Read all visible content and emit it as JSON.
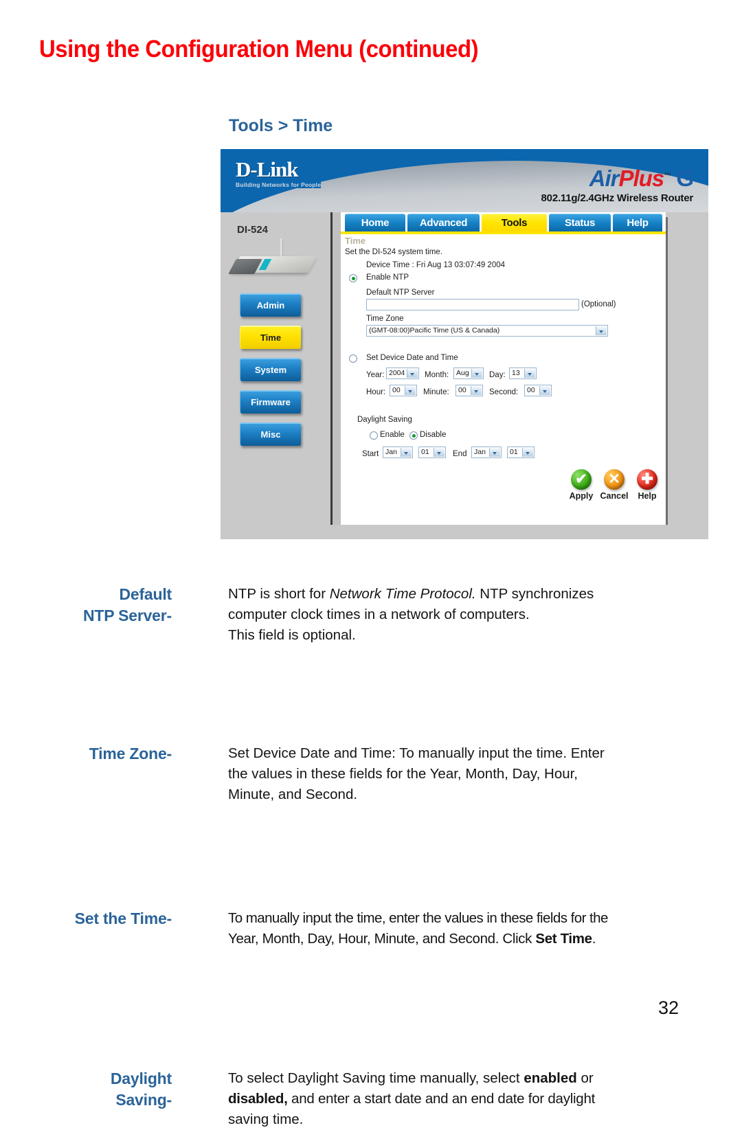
{
  "page": {
    "title": "Using the Configuration Menu (continued)",
    "section_heading": "Tools > Time",
    "page_number": "32",
    "title_color": "#fb0008",
    "heading_color": "#2b6399"
  },
  "screenshot": {
    "brand": {
      "logo": "D-Link",
      "tagline": "Building Networks for People",
      "product_air": "Air",
      "product_plus": "Plus",
      "product_tm": "™",
      "product_g": "G",
      "subtitle": "802.11g/2.4GHz Wireless Router"
    },
    "tabs": [
      {
        "label": "Home",
        "active": false
      },
      {
        "label": "Advanced",
        "active": false
      },
      {
        "label": "Tools",
        "active": true
      },
      {
        "label": "Status",
        "active": false
      },
      {
        "label": "Help",
        "active": false
      }
    ],
    "device": {
      "model": "DI-524",
      "buttons": [
        {
          "label": "Admin",
          "active": false
        },
        {
          "label": "Time",
          "active": true
        },
        {
          "label": "System",
          "active": false
        },
        {
          "label": "Firmware",
          "active": false
        },
        {
          "label": "Misc",
          "active": false
        }
      ]
    },
    "form": {
      "title": "Time",
      "description": "Set the DI-524 system time.",
      "device_time": "Device Time : Fri Aug 13 03:07:49 2004",
      "enable_ntp_label": "Enable NTP",
      "enable_ntp_selected": true,
      "ntp_server_label": "Default NTP Server",
      "ntp_server_value": "",
      "ntp_server_optional": "(Optional)",
      "time_zone_label": "Time Zone",
      "time_zone_value": "(GMT-08:00)Pacific Time (US & Canada)",
      "set_device_label": "Set Device Date and Time",
      "set_device_selected": false,
      "year_label": "Year:",
      "year_value": "2004",
      "month_label": "Month:",
      "month_value": "Aug",
      "day_label": "Day:",
      "day_value": "13",
      "hour_label": "Hour:",
      "hour_value": "00",
      "minute_label": "Minute:",
      "minute_value": "00",
      "second_label": "Second:",
      "second_value": "00",
      "daylight_label": "Daylight Saving",
      "daylight_enable_label": "Enable",
      "daylight_disable_label": "Disable",
      "daylight_selected": "Disable",
      "start_label": "Start",
      "start_month_value": "Jan",
      "start_day_value": "01",
      "end_label": "End",
      "end_month_value": "Jan",
      "end_day_value": "01"
    },
    "actions": [
      {
        "label": "Apply",
        "glyph": "✔",
        "color": "#3fae18"
      },
      {
        "label": "Cancel",
        "glyph": "✕",
        "color": "#f09418"
      },
      {
        "label": "Help",
        "glyph": "✚",
        "color": "#e02a1c"
      }
    ]
  },
  "definitions": [
    {
      "term_line1": "Default",
      "term_line2": "NTP Server-",
      "lines": [
        {
          "pre": "NTP is short for ",
          "italic": "Network Time Protocol.",
          "post": " NTP synchronizes",
          "justify": true
        },
        {
          "pre": "computer clock times in a network of computers.",
          "italic": "",
          "post": "",
          "justify": false
        },
        {
          "pre": "This field is optional.",
          "italic": "",
          "post": "",
          "justify": false
        }
      ]
    },
    {
      "term_line1": "Time Zone-",
      "term_line2": "",
      "lines": [
        {
          "pre": "Set Device Date and Time: To manually input the time. Enter",
          "italic": "",
          "post": "",
          "justify": true
        },
        {
          "pre": "the values in these fields for the Year, Month, Day, Hour,",
          "italic": "",
          "post": "",
          "justify": true
        },
        {
          "pre": "Minute, and Second.",
          "italic": "",
          "post": "",
          "justify": false
        }
      ]
    },
    {
      "term_line1": "Set the Time-",
      "term_line2": "",
      "lines": [
        {
          "pre": "To manually input the time, enter the values in these fields for the",
          "italic": "",
          "post": "",
          "justify": false
        },
        {
          "pre": "Year, Month, Day, Hour, Minute, and Second. Click ",
          "bold": "Set Time",
          "post": ".",
          "justify": false
        }
      ]
    },
    {
      "term_line1": "Daylight",
      "term_line2": "Saving-",
      "lines": [
        {
          "pre": "To select Daylight Saving time manually, select ",
          "bold": "enabled",
          "post": " or",
          "justify": true
        },
        {
          "bold": "disabled,",
          "post": " and enter a start date and an end date for daylight",
          "pre": "",
          "justify": true
        },
        {
          "pre": "saving time.",
          "italic": "",
          "post": "",
          "justify": false
        }
      ]
    }
  ]
}
